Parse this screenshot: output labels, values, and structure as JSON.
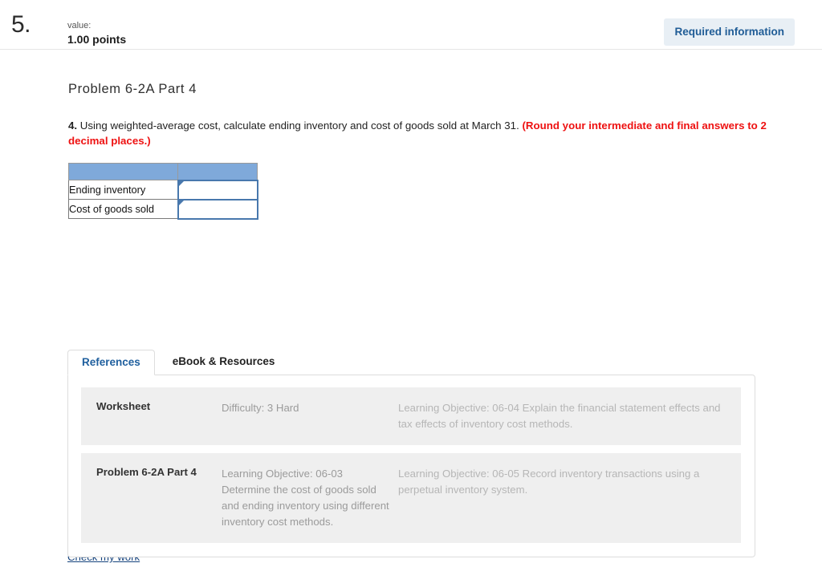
{
  "header": {
    "question_number": "5.",
    "value_label": "value:",
    "points": "1.00 points",
    "required_information_badge": "Required information",
    "badge_bg_color": "#e8eff5",
    "badge_text_color": "#1f5c96"
  },
  "problem": {
    "title": "Problem 6-2A Part 4",
    "question_prefix": "4.",
    "question_text": " Using weighted-average cost, calculate ending inventory and cost of goods sold at March 31. ",
    "round_note": "(Round your intermediate and final answers to 2 decimal places.)",
    "round_note_color": "#ee1111"
  },
  "answer_table": {
    "header_color": "#7fa9da",
    "input_border_color": "#4878ad",
    "header_cells": [
      "",
      ""
    ],
    "rows": [
      {
        "label": "Ending inventory",
        "value": ""
      },
      {
        "label": "Cost of goods sold",
        "value": ""
      }
    ]
  },
  "references": {
    "tabs": [
      {
        "label": "References",
        "active": true
      },
      {
        "label": "eBook & Resources",
        "active": false
      }
    ],
    "rows": [
      {
        "title": "Worksheet",
        "difficulty": "Difficulty: 3 Hard",
        "objective": "Learning Objective: 06-04 Explain the financial statement effects and tax effects of inventory cost methods."
      },
      {
        "title": "Problem 6-2A Part 4",
        "difficulty": "Learning Objective: 06-03 Determine the cost of goods sold and ending inventory using different inventory cost methods.",
        "objective": "Learning Objective: 06-05 Record inventory transactions using a perpetual inventory system."
      }
    ]
  },
  "footer": {
    "check_my_work": "Check my work"
  }
}
